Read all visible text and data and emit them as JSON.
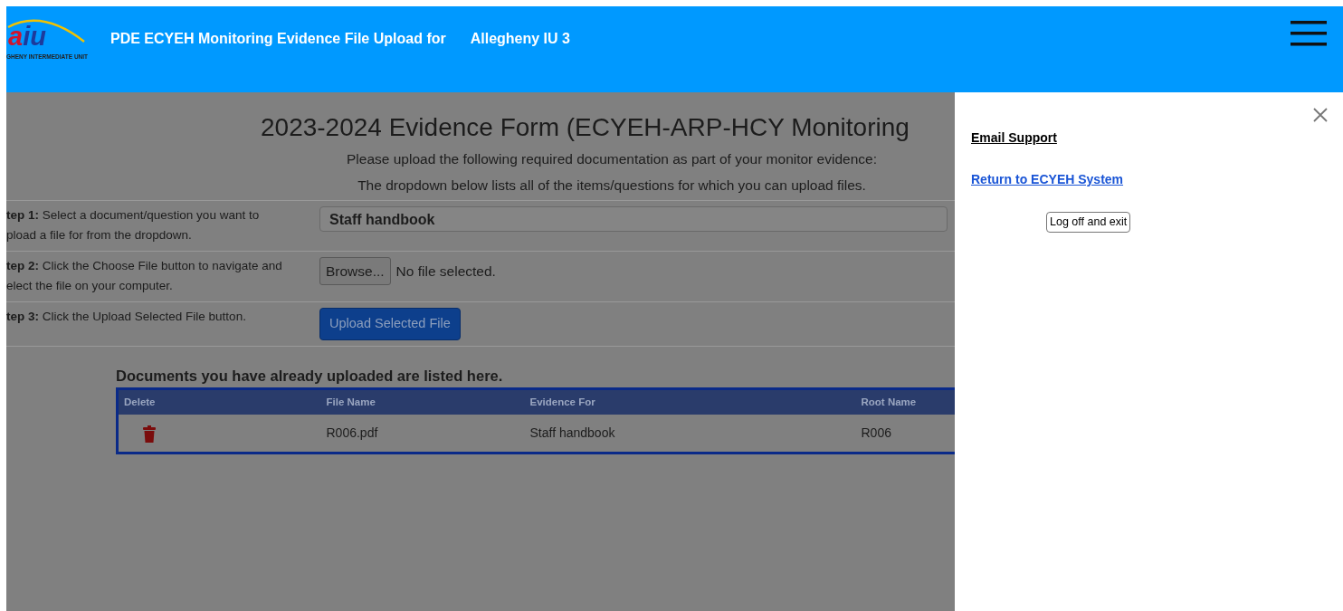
{
  "header": {
    "logo": {
      "first": "a",
      "rest": "iu",
      "tagline": "GHENY INTERMEDIATE UNIT"
    },
    "title": "PDE ECYEH Monitoring Evidence File Upload for",
    "organization": "Allegheny IU 3"
  },
  "main": {
    "title": "2023-2024 Evidence Form (ECYEH-ARP-HCY Monitoring",
    "intro": [
      "Please upload the following required documentation as part of your monitor evidence:",
      "The dropdown below lists all of the items/questions for which you can upload files."
    ],
    "steps": [
      {
        "kind": "select",
        "lines": [
          "**tep 1:** Select a document/question you want to",
          "pload a file for from the dropdown."
        ],
        "value": "Staff handbook"
      },
      {
        "kind": "file",
        "lines": [
          "**tep 2:** Click the Choose File button to navigate and",
          "elect the file on your computer."
        ],
        "button": "Browse...",
        "status": "No file selected."
      },
      {
        "kind": "button",
        "lines": [
          "**tep 3:** Click the Upload Selected File button."
        ],
        "button": "Upload Selected File"
      }
    ],
    "uploads": {
      "heading": "Documents you have already uploaded are listed here.",
      "columns": [
        "Delete",
        "File Name",
        "Evidence For",
        "Root Name"
      ],
      "rows": [
        {
          "cells": [
            "",
            "R006.pdf",
            "Staff handbook",
            "R006"
          ]
        }
      ]
    }
  },
  "offcanvas": {
    "links": [
      {
        "kind": "plain",
        "label": "Email Support"
      },
      {
        "kind": "link",
        "label": "Return to ECYEH System"
      }
    ],
    "logoff": "Log off and exit"
  }
}
